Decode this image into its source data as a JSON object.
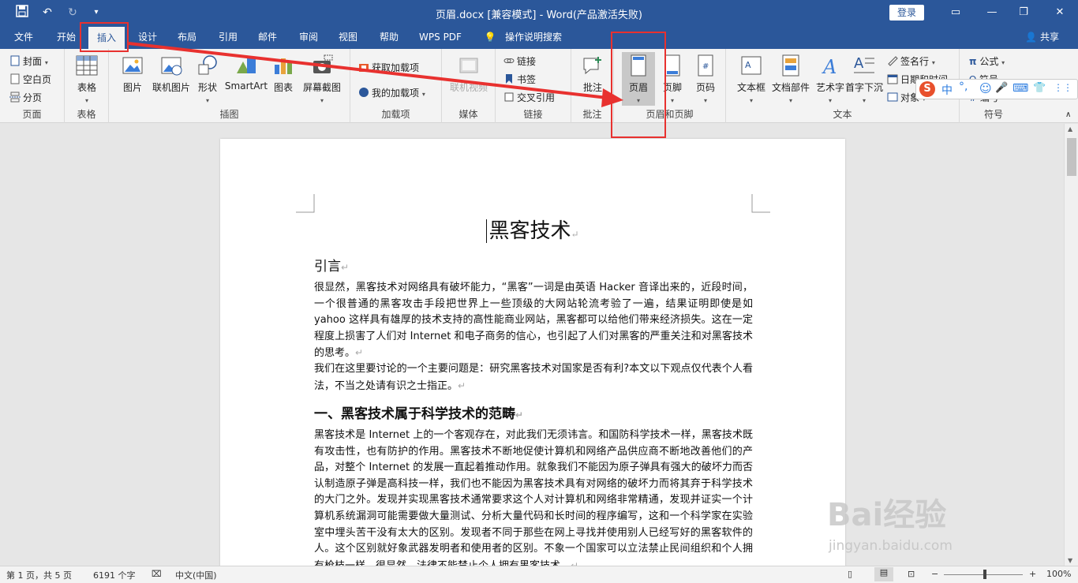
{
  "titlebar": {
    "title": "页眉.docx [兼容模式]  -  Word(产品激活失败)",
    "login": "登录",
    "save_icon": "save-icon",
    "undo_icon": "undo-icon",
    "redo_icon": "redo-icon"
  },
  "tabs": [
    "文件",
    "开始",
    "插入",
    "设计",
    "布局",
    "引用",
    "邮件",
    "审阅",
    "视图",
    "帮助",
    "WPS PDF",
    "操作说明搜索"
  ],
  "share": "共享",
  "ribbon": {
    "page_group": {
      "label": "页面",
      "items": [
        "封面",
        "空白页",
        "分页"
      ]
    },
    "table_group": {
      "label": "表格",
      "btn": "表格"
    },
    "illus_group": {
      "label": "插图",
      "btns": [
        "图片",
        "联机图片",
        "形状",
        "SmartArt",
        "图表",
        "屏幕截图"
      ]
    },
    "addin_group": {
      "label": "加载项",
      "items": [
        "获取加载项",
        "我的加载项"
      ]
    },
    "media_group": {
      "label": "媒体",
      "btn": "联机视频"
    },
    "link_group": {
      "label": "链接",
      "items": [
        "链接",
        "书签",
        "交叉引用"
      ]
    },
    "comment_group": {
      "label": "批注",
      "btn": "批注"
    },
    "hf_group": {
      "label": "页眉和页脚",
      "btns": [
        "页眉",
        "页脚",
        "页码"
      ]
    },
    "text_group": {
      "label": "文本",
      "btns": [
        "文本框",
        "文档部件",
        "艺术字",
        "首字下沉"
      ],
      "items": [
        "签名行",
        "日期和时间",
        "对象"
      ]
    },
    "symbol_group": {
      "label": "符号",
      "items": [
        "公式",
        "符号",
        "编号"
      ]
    }
  },
  "ime": {
    "items": [
      "S",
      "中",
      "°,",
      "☺",
      "🎤",
      "⌨",
      "👕",
      "⋮⋮"
    ]
  },
  "doc": {
    "title": "黑客技术",
    "h1": "引言",
    "p1": "很显然，黑客技术对网络具有破坏能力，“黑客”一词是由英语 Hacker 音译出来的，近段时间，一个很普通的黑客攻击手段把世界上一些顶级的大网站轮流考验了一遍，结果证明即使是如 yahoo 这样具有雄厚的技术支持的高性能商业网站，黑客都可以给他们带来经济损失。这在一定程度上损害了人们对 Internet 和电子商务的信心，也引起了人们对黑客的严重关注和对黑客技术的思考。",
    "p2": "我们在这里要讨论的一个主要问题是：研究黑客技术对国家是否有利?本文以下观点仅代表个人看法，不当之处请有识之士指正。",
    "h2": "一、黑客技术属于科学技术的范畴",
    "p3": "黑客技术是 Internet 上的一个客观存在，对此我们无须讳言。和国防科学技术一样，黑客技术既有攻击性，也有防护的作用。黑客技术不断地促使计算机和网络产品供应商不断地改善他们的产品，对整个 Internet 的发展一直起着推动作用。就象我们不能因为原子弹具有强大的破坏力而否认制造原子弹是高科技一样，我们也不能因为黑客技术具有对网络的破坏力而将其弃于科学技术的大门之外。发现并实现黑客技术通常要求这个人对计算机和网络非常精通，发现并证实一个计算机系统漏洞可能需要做大量测试、分析大量代码和长时间的程序编写，这和一个科学家在实验室中埋头苦干没有太大的区别。发现者不同于那些在网上寻找并使用别人已经写好的黑客软件的人。这个区别就好象武器发明者和使用者的区别。不象一个国家可以立法禁止民间组织和个人拥有枪枝一样，很显然，法律不能禁止个人拥有黑客技术。",
    "para_mark": "↵"
  },
  "status": {
    "page": "第 1 页，共 5 页",
    "words": "6191 个字",
    "lang": "中文(中国)",
    "zoom": "100%"
  },
  "watermark": {
    "main": "Bai经验",
    "sub": "jingyan.baidu.com"
  },
  "colors": {
    "accent": "#2b579a",
    "highlight": "#e8312f"
  }
}
